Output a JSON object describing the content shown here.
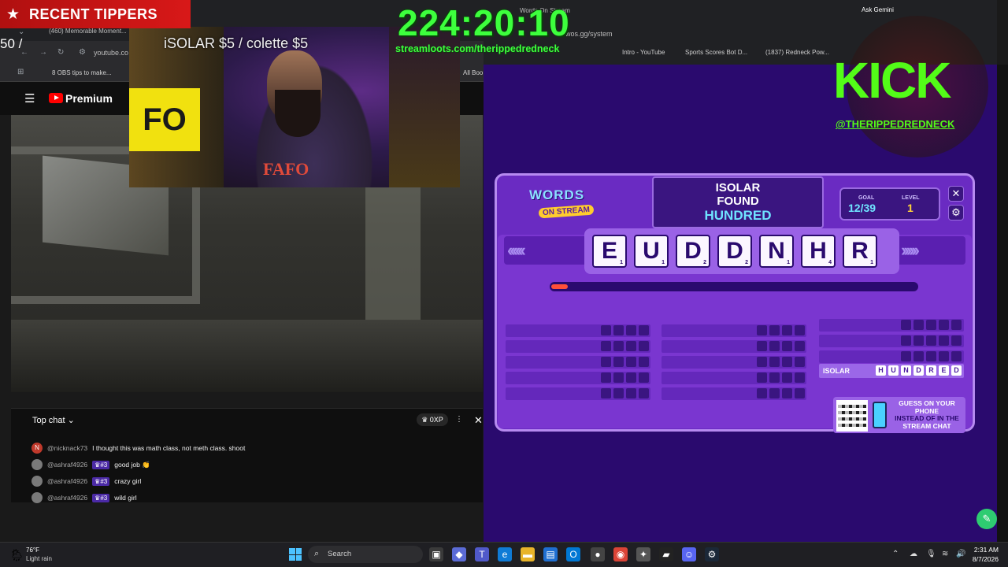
{
  "overlay": {
    "recent_tippers_title": "RECENT TIPPERS",
    "tip_ticker": "iSOLAR $5 / colette $5",
    "partial_amount": "50 /",
    "countdown": "224:20:10",
    "promo_url": "streamloots.com/therippedredneck",
    "kick_logo": "KICK",
    "kick_handle": "@THERIPPEDREDNECK",
    "webcam_sign": "FO",
    "webcam_shirt": "FAFO"
  },
  "browser": {
    "tabs": [
      "(460) Memorable Moment...",
      "Words On Stream",
      "Ask Gemini"
    ],
    "address": "youtube.co",
    "address_right": "wos.gg/system",
    "bookmarks": [
      "8 OBS tips to make...",
      "Intro - YouTube",
      "Sports Scores Bot D...",
      "(1837) Redneck Pow...",
      "All Boo"
    ]
  },
  "youtube": {
    "brand": "Premium"
  },
  "live_chat": {
    "title": "Top chat",
    "xp": "0XP",
    "messages": [
      {
        "avatar": "N",
        "user": "@nicknack73",
        "badge": "",
        "text": "I thought this was math class, not meth class. shoot"
      },
      {
        "avatar": "",
        "user": "@ashraf4926",
        "badge": "#3",
        "text": "good job 👏"
      },
      {
        "avatar": "",
        "user": "@ashraf4926",
        "badge": "#3",
        "text": "crazy girl"
      },
      {
        "avatar": "",
        "user": "@ashraf4926",
        "badge": "#3",
        "text": "wild girl"
      }
    ]
  },
  "game": {
    "logo_words": "WORDS",
    "logo_stream": "ON STREAM",
    "found_player": "ISOLAR",
    "found_label": "FOUND",
    "found_word": "HUNDRED",
    "goal_label": "GOAL",
    "goal_value": "12/39",
    "level_label": "LEVEL",
    "level_value": "1",
    "tiles": [
      {
        "letter": "E",
        "score": "1"
      },
      {
        "letter": "U",
        "score": "1"
      },
      {
        "letter": "D",
        "score": "2"
      },
      {
        "letter": "D",
        "score": "2"
      },
      {
        "letter": "N",
        "score": "1"
      },
      {
        "letter": "H",
        "score": "4"
      },
      {
        "letter": "R",
        "score": "1"
      }
    ],
    "progress_fraction": 0.045,
    "solved_name": "ISOLAR",
    "solved_letters": [
      "H",
      "U",
      "N",
      "D",
      "R",
      "E",
      "D"
    ],
    "qr_text_a": "GUESS ON YOUR PHONE",
    "qr_text_b": "INSTEAD OF IN THE",
    "qr_text_c": "STREAM CHAT",
    "accent_color": "#6fe3ff"
  },
  "taskbar": {
    "temp": "76°F",
    "weather": "Light rain",
    "search_placeholder": "Search",
    "time": "2:31 AM",
    "date": "8/7/2026"
  }
}
